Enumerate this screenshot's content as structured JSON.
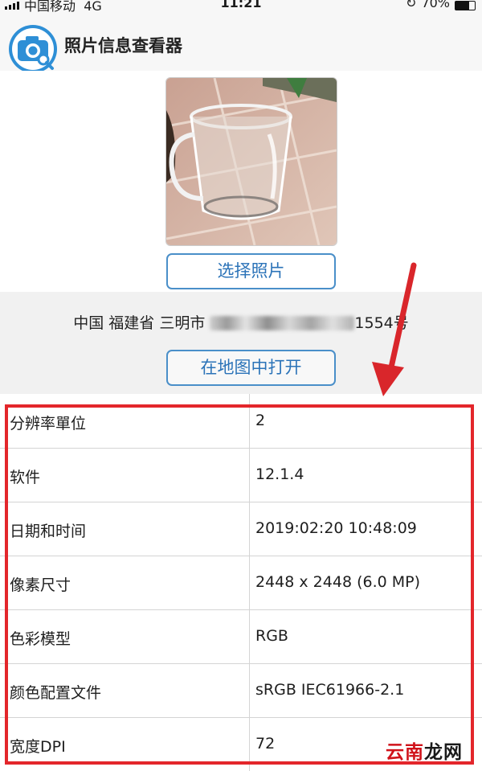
{
  "status_bar": {
    "carrier": "中国移动",
    "network": "4G",
    "time": "11:21",
    "battery": "70%",
    "battery_level": 0.7
  },
  "header": {
    "title": "照片信息查看器",
    "icon": "camera-search-icon"
  },
  "photo": {
    "select_button": "选择照片"
  },
  "location": {
    "address": "中国 福建省 三明市",
    "address_suffix": "1554号",
    "open_map_button": "在地图中打开"
  },
  "info_rows": [
    {
      "key": "分辨率單位",
      "value": "2"
    },
    {
      "key": "软件",
      "value": "12.1.4"
    },
    {
      "key": "日期和时间",
      "value": "2019:02:20 10:48:09"
    },
    {
      "key": "像素尺寸",
      "value": "2448 x 2448 (6.0 MP)"
    },
    {
      "key": "色彩模型",
      "value": "RGB"
    },
    {
      "key": "颜色配置文件",
      "value": "sRGB IEC61966-2.1"
    },
    {
      "key": "宽度DPI",
      "value": "72"
    }
  ],
  "watermark": {
    "part1": "云南",
    "part2": "龙网"
  },
  "colors": {
    "accent": "#2b73b8",
    "highlight": "#e3262b"
  }
}
